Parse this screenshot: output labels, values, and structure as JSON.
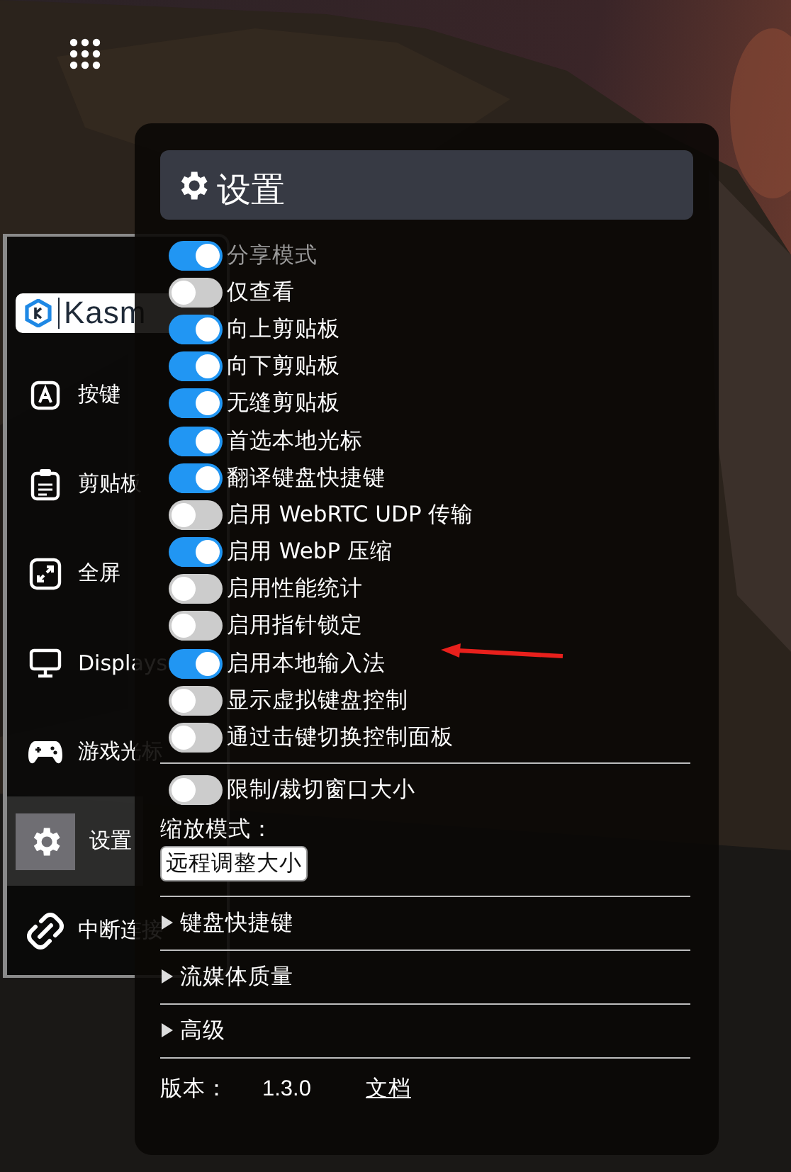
{
  "launcher": {
    "kind": "grid"
  },
  "sidebar": {
    "logo": "Kasm",
    "items": [
      {
        "label": "按键",
        "selected": false
      },
      {
        "label": "剪贴板",
        "selected": false
      },
      {
        "label": "全屏",
        "selected": false
      },
      {
        "label": "Displays",
        "selected": false
      },
      {
        "label": "游戏光标",
        "selected": false
      },
      {
        "label": "设置",
        "selected": true
      },
      {
        "label": "中断连接",
        "selected": false
      }
    ]
  },
  "settings": {
    "title": "设置",
    "toggles": [
      {
        "label": "分享模式",
        "on": true,
        "disabled": true
      },
      {
        "label": "仅查看",
        "on": false,
        "disabled": false
      },
      {
        "label": "向上剪贴板",
        "on": true,
        "disabled": false
      },
      {
        "label": "向下剪贴板",
        "on": true,
        "disabled": false
      },
      {
        "label": "无缝剪贴板",
        "on": true,
        "disabled": false
      },
      {
        "label": "首选本地光标",
        "on": true,
        "disabled": false
      },
      {
        "label": "翻译键盘快捷键",
        "on": true,
        "disabled": false
      },
      {
        "label": "启用 WebRTC UDP 传输",
        "on": false,
        "disabled": false
      },
      {
        "label": "启用 WebP 压缩",
        "on": true,
        "disabled": false
      },
      {
        "label": "启用性能统计",
        "on": false,
        "disabled": false
      },
      {
        "label": "启用指针锁定",
        "on": false,
        "disabled": false
      },
      {
        "label": "启用本地输入法",
        "on": true,
        "disabled": false,
        "annotated": true
      },
      {
        "label": "显示虚拟键盘控制",
        "on": false,
        "disabled": false
      },
      {
        "label": "通过击键切换控制面板",
        "on": false,
        "disabled": false
      }
    ],
    "clip_toggle": {
      "label": "限制/裁切窗口大小",
      "on": false,
      "disabled": false
    },
    "scaling": {
      "label": "缩放模式：",
      "value": "远程调整大小"
    },
    "sections": [
      {
        "label": "键盘快捷键",
        "expanded": false
      },
      {
        "label": "流媒体质量",
        "expanded": false
      },
      {
        "label": "高级",
        "expanded": false
      }
    ],
    "footer": {
      "version_label": "版本：",
      "version": "1.3.0",
      "docs_link": "文档"
    }
  }
}
